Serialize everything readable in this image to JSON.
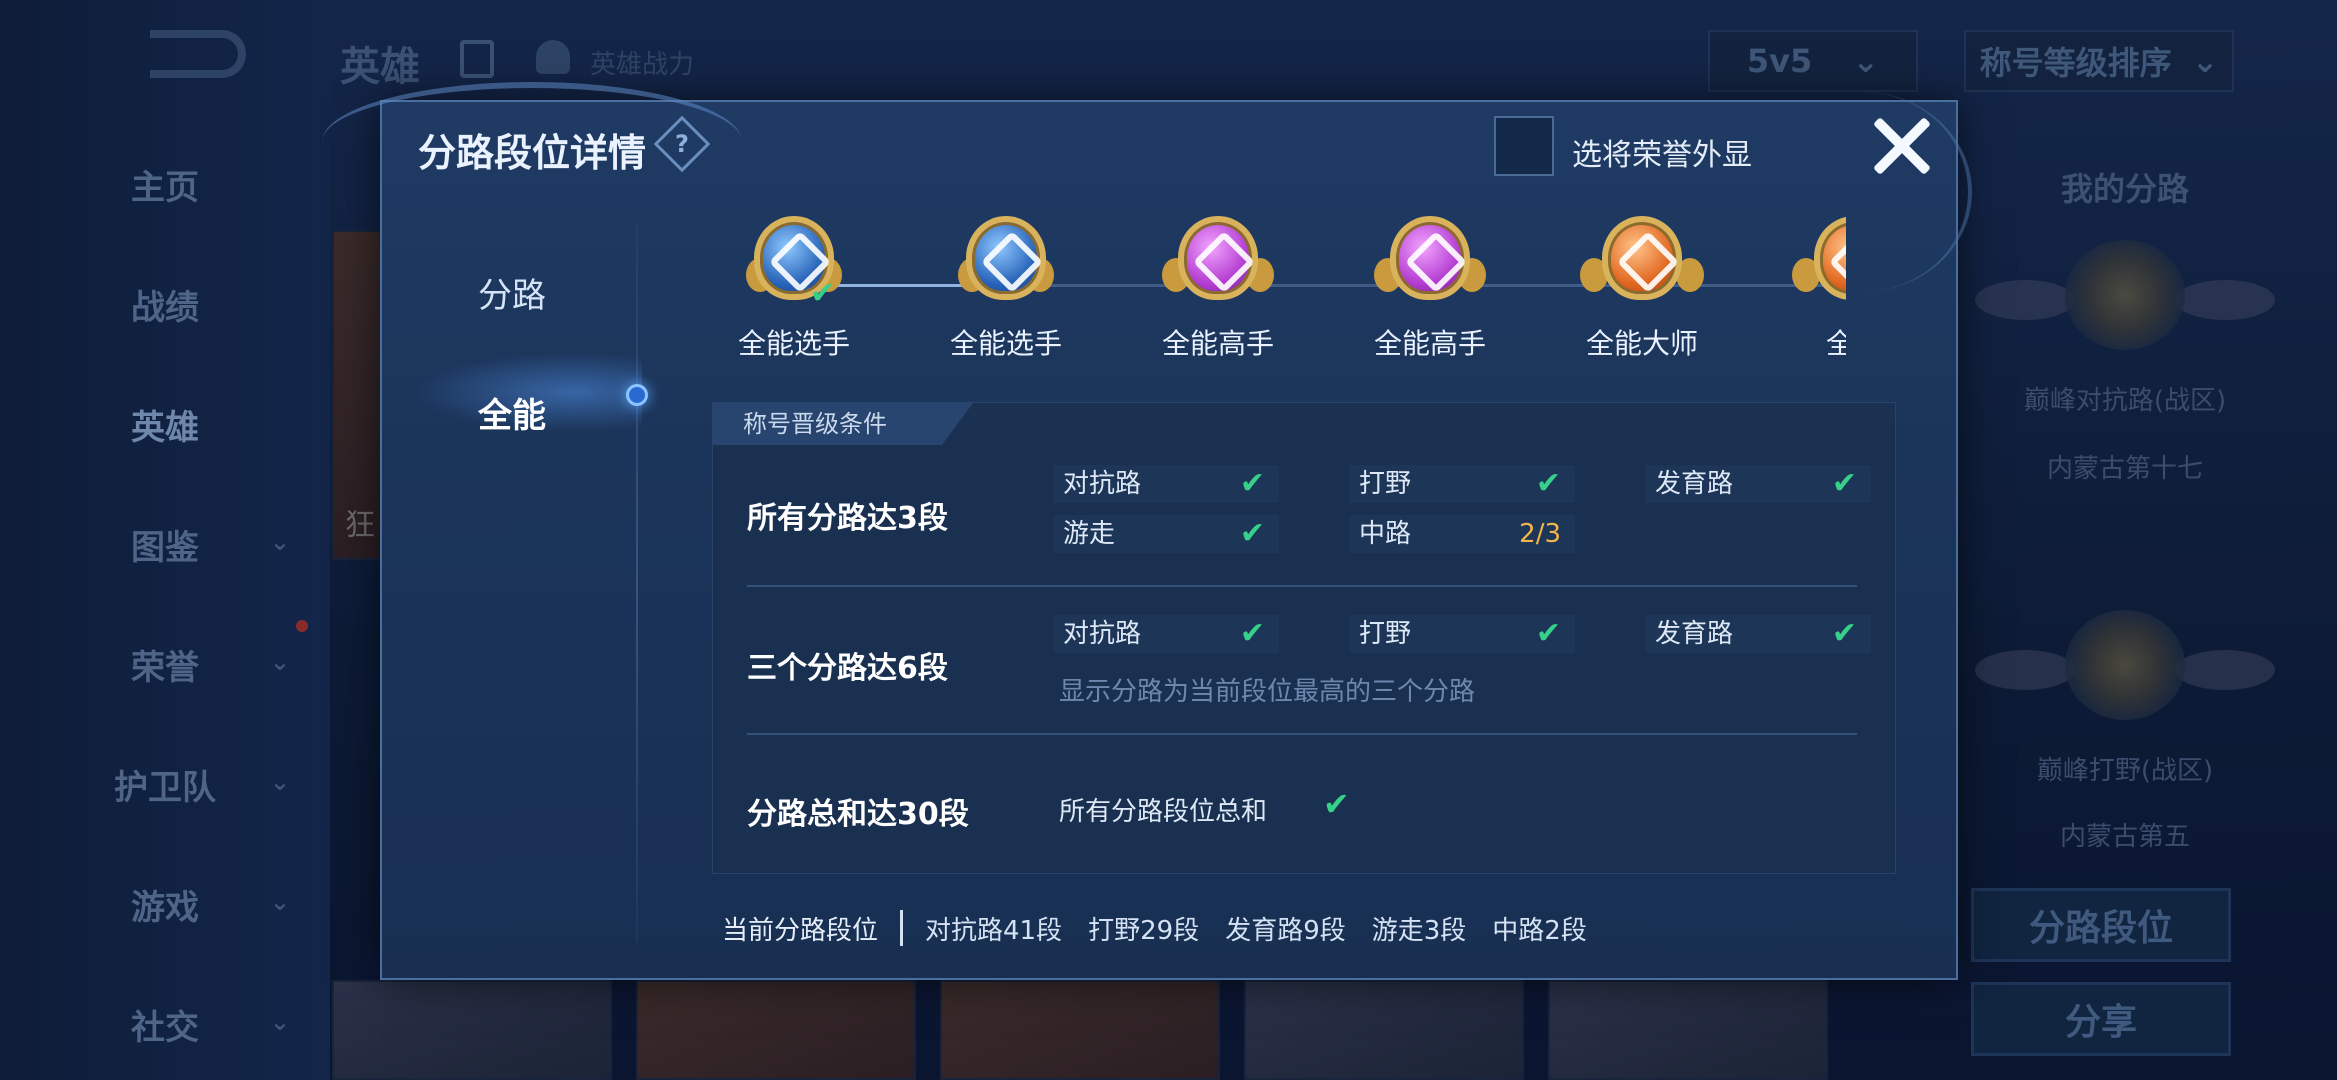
{
  "background": {
    "nav": [
      {
        "label": "主页",
        "chevron": false
      },
      {
        "label": "战绩",
        "chevron": false
      },
      {
        "label": "英雄",
        "chevron": false,
        "active": true
      },
      {
        "label": "图鉴",
        "chevron": true
      },
      {
        "label": "荣誉",
        "chevron": true
      },
      {
        "label": "护卫队",
        "chevron": true
      },
      {
        "label": "游戏",
        "chevron": true
      },
      {
        "label": "社交",
        "chevron": true
      }
    ],
    "header": {
      "title": "英雄",
      "power_label": "英雄战力"
    },
    "mode_select": {
      "value": "5v5"
    },
    "sort_select": {
      "value": "称号等级排序"
    },
    "hero_card_text": "狂",
    "right_panel": {
      "title": "我的分路",
      "entries": [
        {
          "label": "巅峰对抗路(战区)",
          "region": "内蒙古第十七"
        },
        {
          "label": "巅峰打野(战区)",
          "region": "内蒙古第五"
        }
      ],
      "buttons": {
        "lanes": "分路段位",
        "share": "分享"
      }
    }
  },
  "modal": {
    "title": "分路段位详情",
    "help_icon": "?",
    "honor_toggle_label": "选将荣誉外显",
    "honor_toggle_checked": false,
    "close_icon": "close-icon",
    "tabs": [
      {
        "label": "分路",
        "active": false
      },
      {
        "label": "全能",
        "active": true
      }
    ],
    "tiers": [
      {
        "name": "全能选手",
        "color": "blue",
        "achieved": true
      },
      {
        "name": "全能选手",
        "color": "blue",
        "achieved": false
      },
      {
        "name": "全能高手",
        "color": "purple",
        "achieved": false
      },
      {
        "name": "全能高手",
        "color": "purple",
        "achieved": false
      },
      {
        "name": "全能大师",
        "color": "orange",
        "achieved": false
      },
      {
        "name": "全能",
        "color": "orange",
        "achieved": false
      }
    ],
    "conditions_header": "称号晋级条件",
    "conditions": [
      {
        "title": "所有分路达3段",
        "requirements": [
          {
            "lane": "对抗路",
            "status": "✔"
          },
          {
            "lane": "打野",
            "status": "✔"
          },
          {
            "lane": "发育路",
            "status": "✔"
          },
          {
            "lane": "游走",
            "status": "✔"
          },
          {
            "lane": "中路",
            "progress": "2/3"
          }
        ]
      },
      {
        "title": "三个分路达6段",
        "requirements": [
          {
            "lane": "对抗路",
            "status": "✔"
          },
          {
            "lane": "打野",
            "status": "✔"
          },
          {
            "lane": "发育路",
            "status": "✔"
          }
        ],
        "note": "显示分路为当前段位最高的三个分路"
      },
      {
        "title": "分路总和达30段",
        "sum_label": "所有分路段位总和",
        "status": "✔"
      }
    ],
    "footer": {
      "label": "当前分路段位",
      "items": [
        "对抗路41段",
        "打野29段",
        "发育路9段",
        "游走3段",
        "中路2段"
      ]
    },
    "colors": {
      "check": "#36d08a",
      "progress": "#f2b54a",
      "accent": "#2a6ad0"
    }
  }
}
